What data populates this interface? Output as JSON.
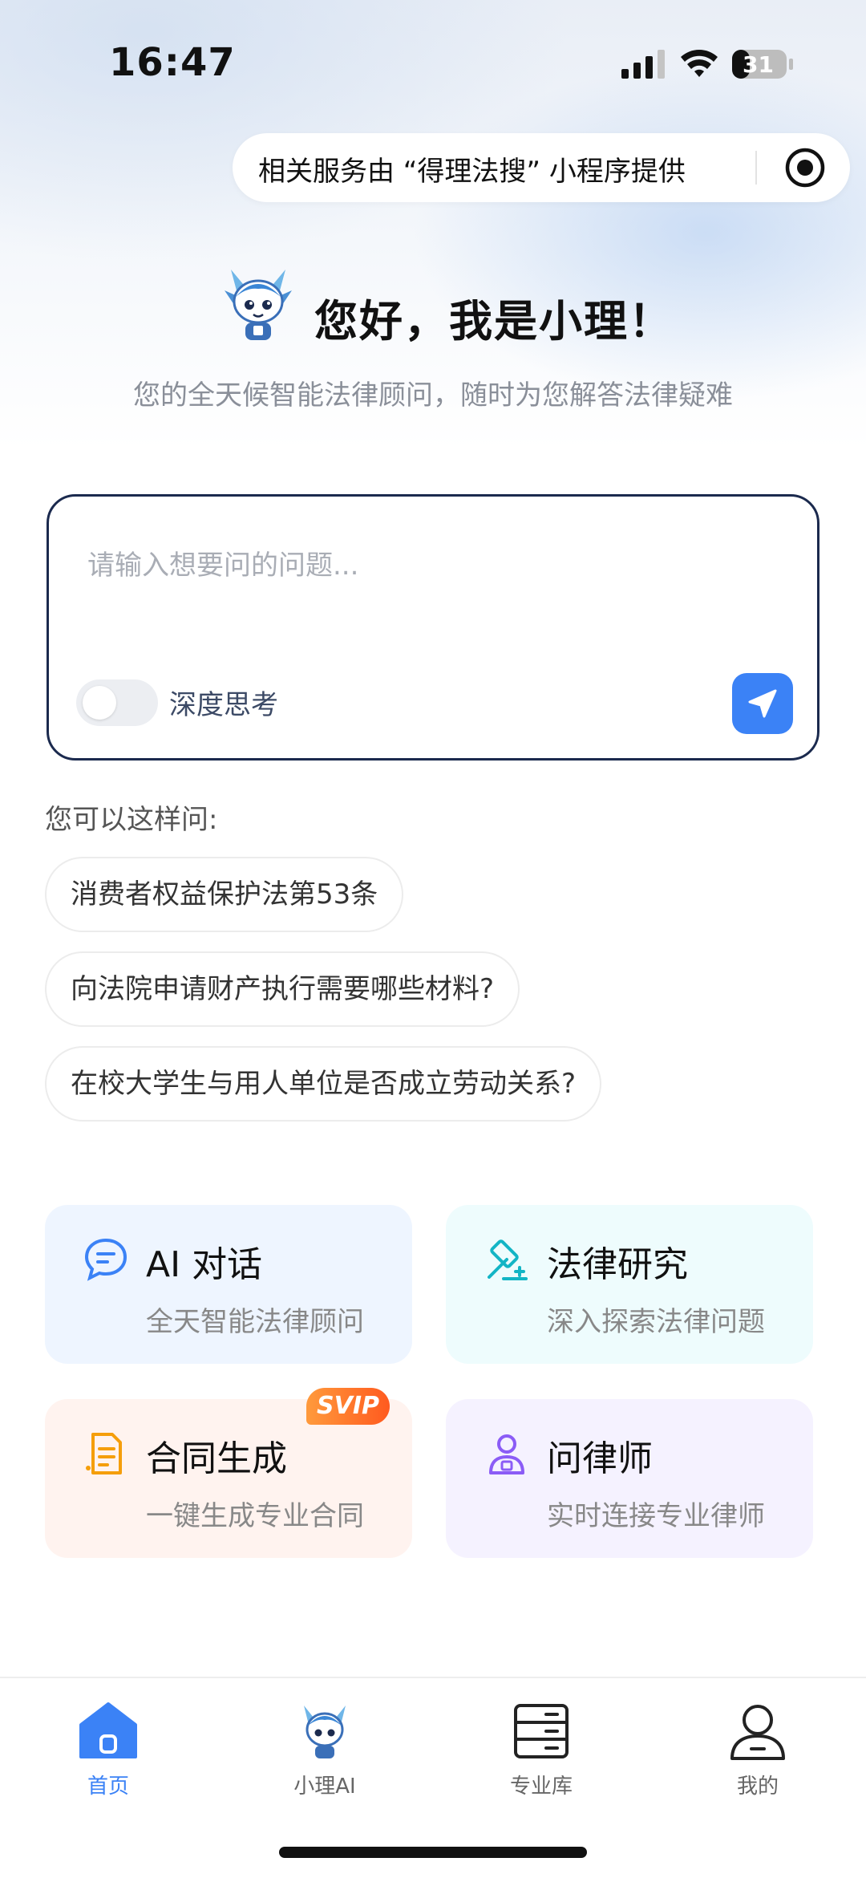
{
  "status_bar": {
    "time": "16:47",
    "battery_level": "31",
    "icons": [
      "signal-icon",
      "wifi-icon",
      "battery-icon"
    ]
  },
  "capsule": {
    "text": "相关服务由 “得理法搜” 小程序提供",
    "icon": "target-icon"
  },
  "greeting": {
    "title": "您好，我是小理！",
    "subtitle": "您的全天候智能法律顾问，随时为您解答法律疑难"
  },
  "input": {
    "placeholder": "请输入想要问的问题...",
    "deep_think_label": "深度思考",
    "deep_think_on": false,
    "send_icon": "send-icon"
  },
  "suggestions": {
    "heading": "您可以这样问:",
    "items": [
      "消费者权益保护法第53条",
      "向法院申请财产执行需要哪些材料?",
      "在校大学生与用人单位是否成立劳动关系?"
    ]
  },
  "features": [
    {
      "title": "AI 对话",
      "subtitle": "全天智能法律顾问",
      "icon": "chat-icon",
      "bg": "#eef5ff",
      "accent": "#3b82f6"
    },
    {
      "title": "法律研究",
      "subtitle": "深入探索法律问题",
      "icon": "gavel-icon",
      "bg": "#eefcfd",
      "accent": "#13b5c5"
    },
    {
      "title": "合同生成",
      "subtitle": "一键生成专业合同",
      "icon": "contract-icon",
      "bg": "#fff3ef",
      "accent": "#f59e0b",
      "badge": "SVIP"
    },
    {
      "title": "问律师",
      "subtitle": "实时连接专业律师",
      "icon": "lawyer-icon",
      "bg": "#f5f2ff",
      "accent": "#8b5cf6"
    }
  ],
  "bottom_nav": [
    {
      "label": "首页",
      "icon": "home-icon",
      "active": true
    },
    {
      "label": "小理AI",
      "icon": "mascot-icon",
      "active": false
    },
    {
      "label": "专业库",
      "icon": "library-icon",
      "active": false
    },
    {
      "label": "我的",
      "icon": "profile-icon",
      "active": false
    }
  ],
  "colors": {
    "accent": "#3b82f6",
    "input_border": "#1b2a4e"
  }
}
